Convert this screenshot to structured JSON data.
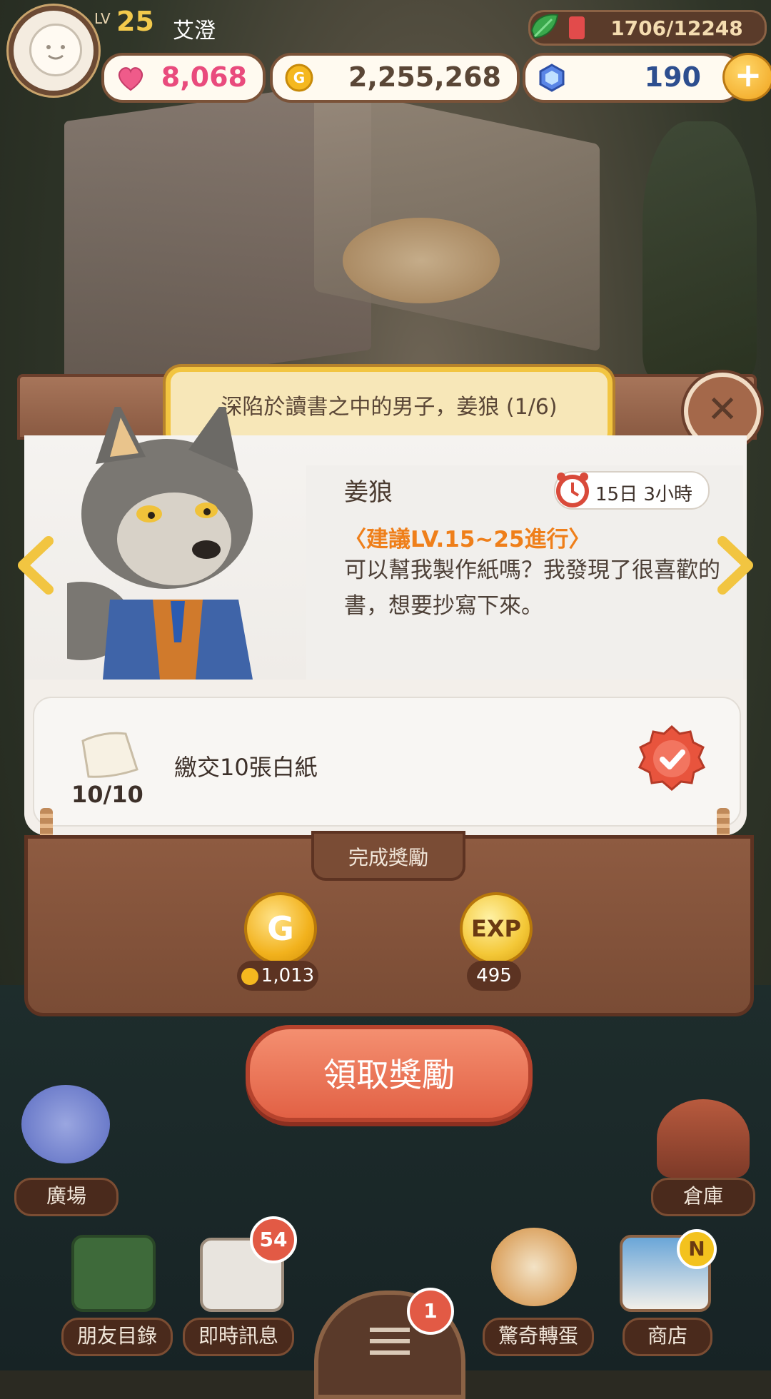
{
  "player": {
    "lv_label": "LV",
    "level": "25",
    "name": "艾澄"
  },
  "exp": {
    "text": "1706/12248",
    "fill_fraction": 0.14
  },
  "resources": {
    "hearts": "8,068",
    "coins": "2,255,268",
    "gems": "190",
    "add_label": "+"
  },
  "dialog": {
    "title": "深陷於讀書之中的男子，姜狼 (1/6)",
    "close_label": "✕",
    "npc_name": "姜狼",
    "timer": "15日 3小時",
    "level_hint": "〈建議LV.15~25進行〉",
    "request": "可以幫我製作紙嗎？我發現了很喜歡的書，想要抄寫下來。",
    "task": {
      "label": "繳交10張白紙",
      "progress": "10/10"
    },
    "reward_header": "完成獎勵",
    "rewards": {
      "coin_symbol": "G",
      "coin_amount": "1,013",
      "exp_symbol": "EXP",
      "exp_amount": "495"
    },
    "claim_label": "領取獎勵"
  },
  "nav": {
    "plaza": "廣場",
    "warehouse": "倉庫",
    "friends": "朋友目錄",
    "messages": "即時訊息",
    "messages_badge": "54",
    "gacha": "驚奇轉蛋",
    "shop": "商店",
    "shop_badge": "N",
    "menu_badge": "1"
  },
  "colors": {
    "accent": "#f2c541",
    "claim": "#e26145",
    "panel": "#8a5a42",
    "level_hint": "#ef7f1a"
  }
}
